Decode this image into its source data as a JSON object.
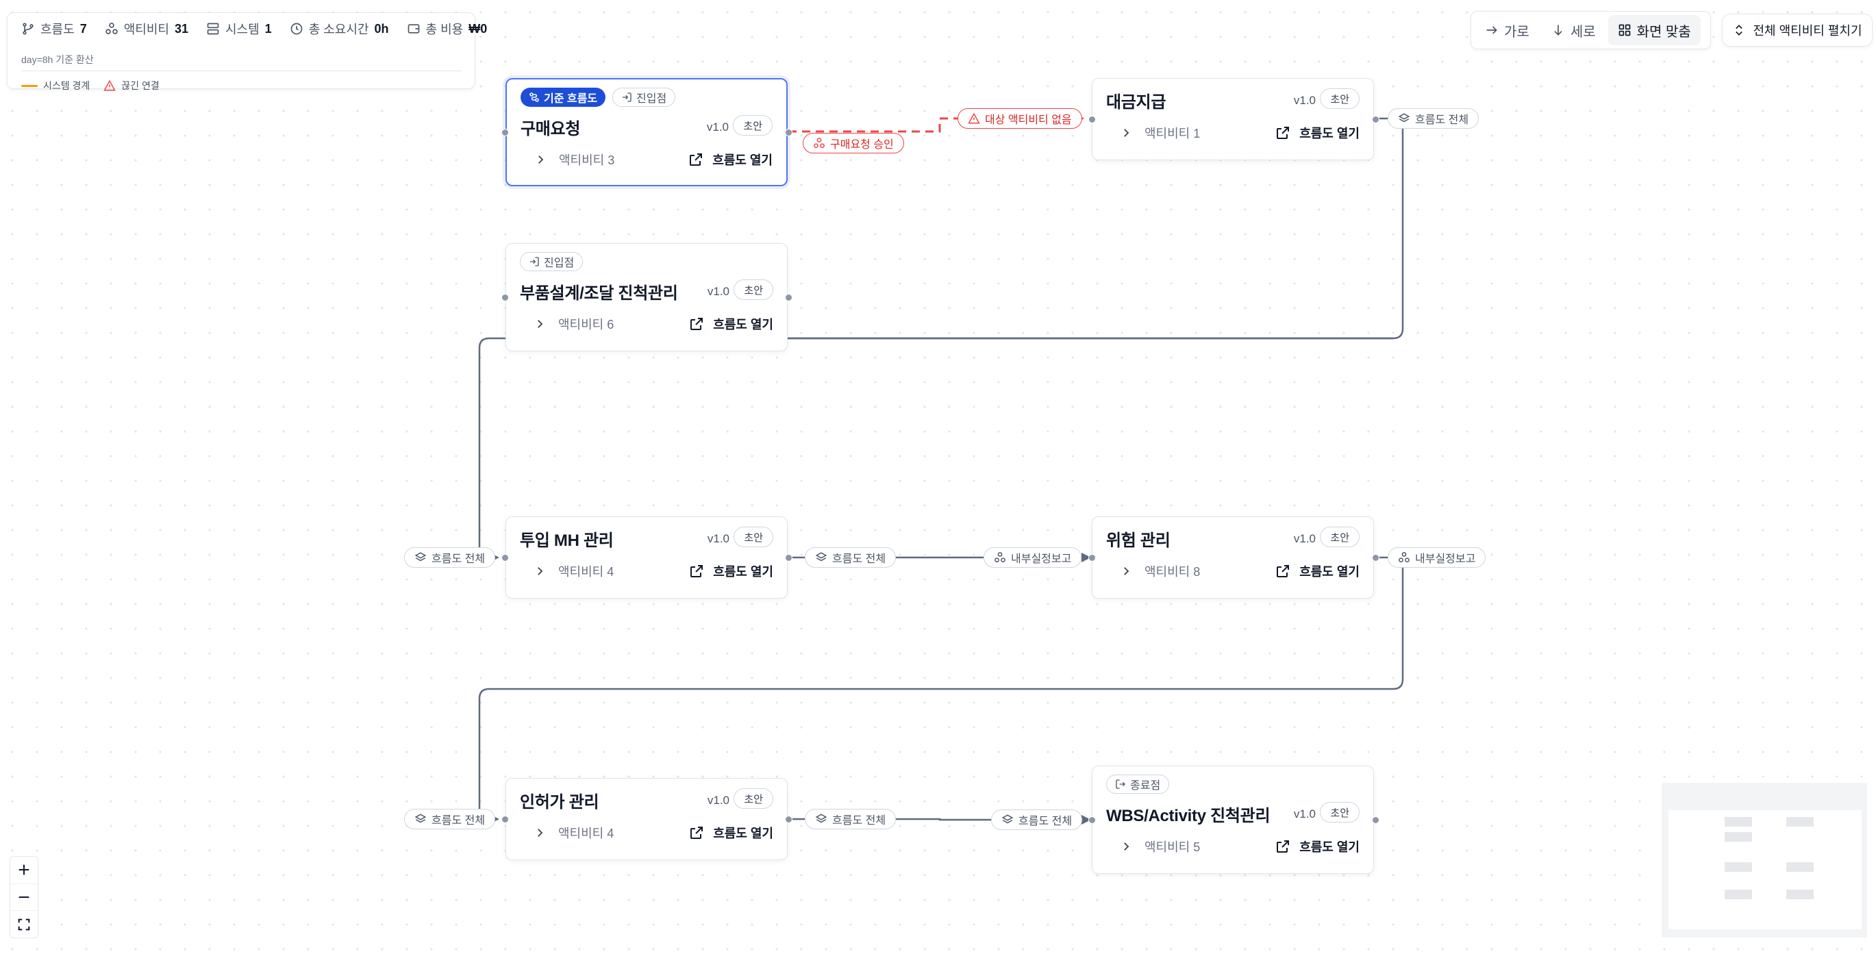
{
  "stats": {
    "flows_label": "흐름도",
    "flows_value": "7",
    "activities_label": "액티비티",
    "activities_value": "31",
    "systems_label": "시스템",
    "systems_value": "1",
    "time_label": "총 소요시간",
    "time_value": "0h",
    "cost_label": "총 비용",
    "cost_value": "₩0",
    "note": "day=8h 기준 환산",
    "legend_boundary": "시스템 경계",
    "legend_broken": "끊긴 연결"
  },
  "toolbar": {
    "horizontal": "가로",
    "vertical": "세로",
    "fit": "화면 맞춤",
    "expand_all": "전체 액티비티 펼치기"
  },
  "nodes": [
    {
      "id": "purchase",
      "badges": [
        "기준 흐름도",
        "진입점"
      ],
      "title": "구매요청",
      "version": "v1.0",
      "status": "초안",
      "activities": "액티비티 3",
      "open": "흐름도 열기"
    },
    {
      "id": "payment",
      "badges": [],
      "title": "대금지급",
      "version": "v1.0",
      "status": "초안",
      "activities": "액티비티 1",
      "open": "흐름도 열기"
    },
    {
      "id": "parts",
      "badges": [
        "진입점"
      ],
      "title": "부품설계/조달 진척관리",
      "version": "v1.0",
      "status": "초안",
      "activities": "액티비티 6",
      "open": "흐름도 열기"
    },
    {
      "id": "mh",
      "badges": [],
      "title": "투입 MH 관리",
      "version": "v1.0",
      "status": "초안",
      "activities": "액티비티 4",
      "open": "흐름도 열기"
    },
    {
      "id": "risk",
      "badges": [],
      "title": "위험 관리",
      "version": "v1.0",
      "status": "초안",
      "activities": "액티비티 8",
      "open": "흐름도 열기"
    },
    {
      "id": "permit",
      "badges": [],
      "title": "인허가 관리",
      "version": "v1.0",
      "status": "초안",
      "activities": "액티비티 4",
      "open": "흐름도 열기"
    },
    {
      "id": "wbs",
      "badges": [
        "종료점"
      ],
      "title": "WBS/Activity 진척관리",
      "version": "v1.0",
      "status": "초안",
      "activities": "액티비티 5",
      "open": "흐름도 열기"
    }
  ],
  "edge_labels": {
    "missing_target": "대상 액티비티 없음",
    "purchase_approval": "구매요청 승인",
    "whole_flow": "흐름도 전체",
    "internal_report": "내부실정보고"
  },
  "colors": {
    "accent": "#1d4ed8",
    "selected_border": "#4f74f0",
    "edge": "#5f6b7e",
    "broken": "#ef4444",
    "boundary": "#f59e0b"
  }
}
